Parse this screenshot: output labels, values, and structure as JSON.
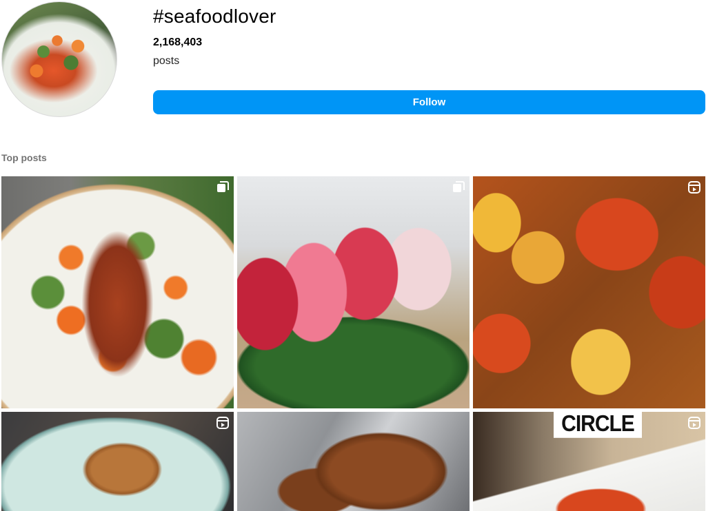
{
  "header": {
    "hashtag": "#seafoodlover",
    "post_count": "2,168,403",
    "post_count_label": "posts",
    "follow_label": "Follow"
  },
  "section": {
    "title": "Top posts"
  },
  "posts": [
    {
      "type": "carousel",
      "badge_icon": "carousel-icon",
      "description_hint": "grilled octopus salad"
    },
    {
      "type": "carousel",
      "badge_icon": "carousel-icon",
      "description_hint": "nigiri sushi"
    },
    {
      "type": "reel",
      "badge_icon": "reel-icon",
      "description_hint": "crawfish boil"
    },
    {
      "type": "reel",
      "badge_icon": "reel-icon",
      "description_hint": "plated dish"
    },
    {
      "type": "image",
      "badge_icon": "",
      "description_hint": "roast chicken"
    },
    {
      "type": "reel",
      "badge_icon": "reel-icon",
      "sign_text": "CIRCLE"
    }
  ],
  "colors": {
    "follow_button": "#0095f6",
    "section_label": "#737373"
  }
}
